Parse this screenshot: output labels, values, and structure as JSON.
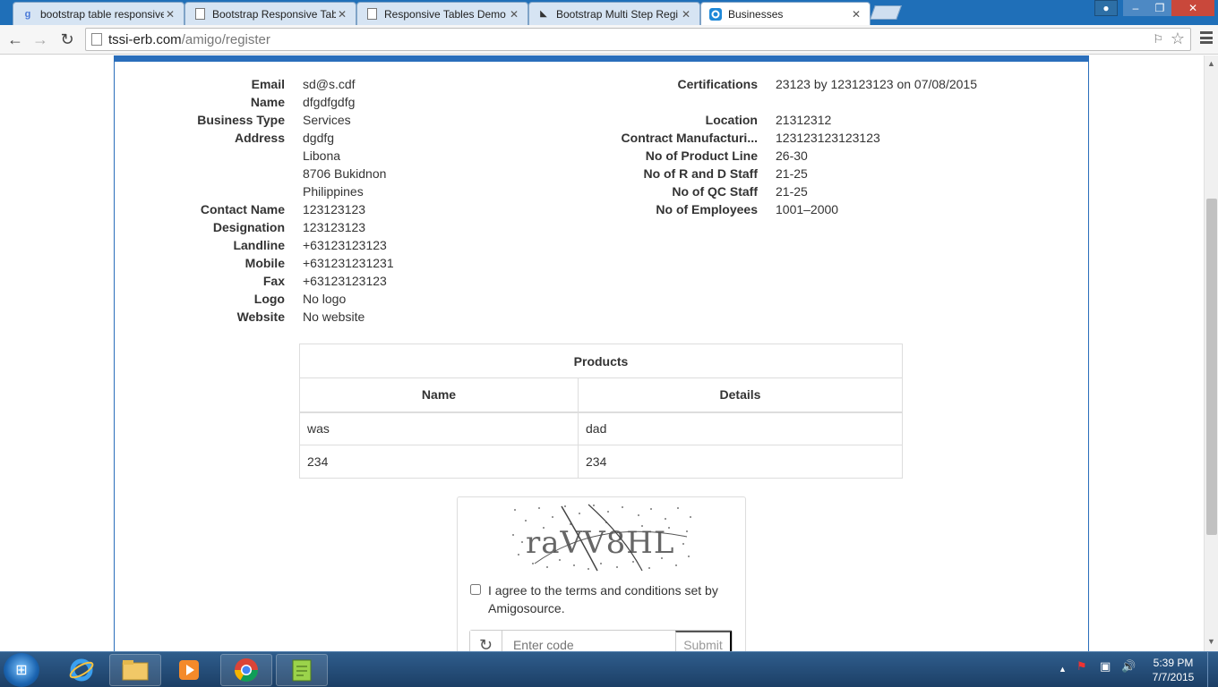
{
  "browser": {
    "tabs": [
      {
        "title": "bootstrap table responsive",
        "favicon": "google-icon",
        "active": false
      },
      {
        "title": "Bootstrap Responsive Tab",
        "favicon": "page-icon",
        "active": false
      },
      {
        "title": "Responsive Tables Demo",
        "favicon": "page-icon",
        "active": false
      },
      {
        "title": "Bootstrap Multi Step Regi",
        "favicon": "page-icon",
        "active": false
      },
      {
        "title": "Businesses",
        "favicon": "amigo-icon",
        "active": true
      }
    ],
    "url_host": "tssi-erb.com",
    "url_path": "/amigo/register"
  },
  "details_left": [
    {
      "label": "Email",
      "value": "sd@s.cdf"
    },
    {
      "label": "Name",
      "value": "dfgdfgdfg"
    },
    {
      "label": "Business Type",
      "value": "Services"
    },
    {
      "label": "Address",
      "value": "dgdfg"
    },
    {
      "label": "",
      "value": "Libona"
    },
    {
      "label": "",
      "value": "8706 Bukidnon"
    },
    {
      "label": "",
      "value": "Philippines"
    },
    {
      "label": "Contact Name",
      "value": "123123123"
    },
    {
      "label": "Designation",
      "value": "123123123"
    },
    {
      "label": "Landline",
      "value": "+63123123123"
    },
    {
      "label": "Mobile",
      "value": "+631231231231"
    },
    {
      "label": "Fax",
      "value": "+63123123123"
    },
    {
      "label": "Logo",
      "value": "No logo"
    },
    {
      "label": "Website",
      "value": "No website"
    }
  ],
  "details_right": {
    "certifications_label": "Certifications",
    "certifications_value": "23123 by 123123123 on 07/08/2015",
    "rows": [
      {
        "label": "Location",
        "value": "21312312"
      },
      {
        "label": "Contract Manufacturi...",
        "value": "123123123123123"
      },
      {
        "label": "No of Product Line",
        "value": "26-30"
      },
      {
        "label": "No of R and D Staff",
        "value": "21-25"
      },
      {
        "label": "No of QC Staff",
        "value": "21-25"
      },
      {
        "label": "No of Employees",
        "value": "1001–2000"
      }
    ]
  },
  "products": {
    "title": "Products",
    "columns": [
      "Name",
      "Details"
    ],
    "rows": [
      [
        "was",
        "dad"
      ],
      [
        "234",
        "234"
      ]
    ]
  },
  "captcha": {
    "image_text": "raVV8HL",
    "agree_text": "I agree to the terms and conditions set by Amigosource.",
    "code_placeholder": "Enter code",
    "submit_label": "Submit"
  },
  "taskbar": {
    "time": "5:39 PM",
    "date": "7/7/2015"
  }
}
